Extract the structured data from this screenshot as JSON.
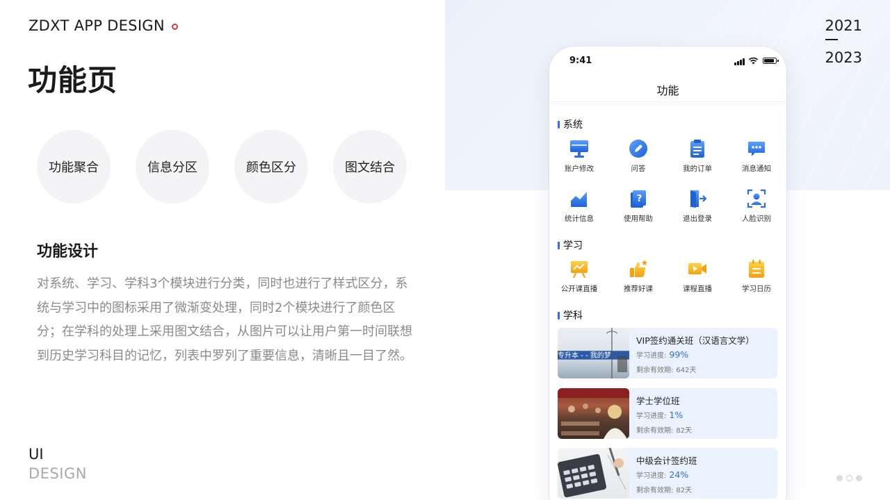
{
  "header": {
    "brand": "ZDXT APP DESIGN",
    "page_title": "功能页"
  },
  "tags": [
    "功能聚合",
    "信息分区",
    "颜色区分",
    "图文结合"
  ],
  "section": {
    "title": "功能设计",
    "description": "对系统、学习、学科3个模块进行分类，同时也进行了样式区分，系统与学习中的图标采用了微渐变处理，同时2个模块进行了颜色区分；在学科的处理上采用图文结合，从图片可以让用户第一时间联想到历史学习科目的记忆，列表中罗列了重要信息，清晰且一目了然。"
  },
  "footer": {
    "ui": "UI",
    "design": "DESIGN"
  },
  "years": {
    "start": "2021",
    "end": "2023"
  },
  "phone": {
    "time": "9:41",
    "nav_title": "功能",
    "system": {
      "title": "系统",
      "items": [
        {
          "label": "账户修改",
          "icon": "monitor-icon"
        },
        {
          "label": "问答",
          "icon": "pen-icon"
        },
        {
          "label": "我的订单",
          "icon": "clipboard-icon"
        },
        {
          "label": "消息通知",
          "icon": "chat-icon"
        },
        {
          "label": "统计信息",
          "icon": "chart-icon"
        },
        {
          "label": "使用帮助",
          "icon": "help-book-icon"
        },
        {
          "label": "退出登录",
          "icon": "logout-icon"
        },
        {
          "label": "人脸识别",
          "icon": "face-scan-icon"
        }
      ]
    },
    "study": {
      "title": "学习",
      "items": [
        {
          "label": "公开课直播",
          "icon": "board-icon"
        },
        {
          "label": "推荐好课",
          "icon": "thumbs-up-icon"
        },
        {
          "label": "课程直播",
          "icon": "video-icon"
        },
        {
          "label": "学习日历",
          "icon": "calendar-icon"
        }
      ]
    },
    "subject": {
      "title": "学科",
      "progress_label": "学习进度:",
      "valid_label": "剩余有效期:",
      "courses": [
        {
          "name": "VIP签约通关班（汉语言文学）",
          "progress": "99%",
          "valid": "642天",
          "thumb_text": "专升本 - - 我的梦"
        },
        {
          "name": "学士学位班",
          "progress": "1%",
          "valid": "82天"
        },
        {
          "name": "中级会计签约班",
          "progress": "24%",
          "valid": "82天"
        }
      ]
    }
  },
  "colors": {
    "accent_blue": "#2f6fe0",
    "accent_yellow": "#f6b61e",
    "card_bg": "#eaf2fe"
  }
}
